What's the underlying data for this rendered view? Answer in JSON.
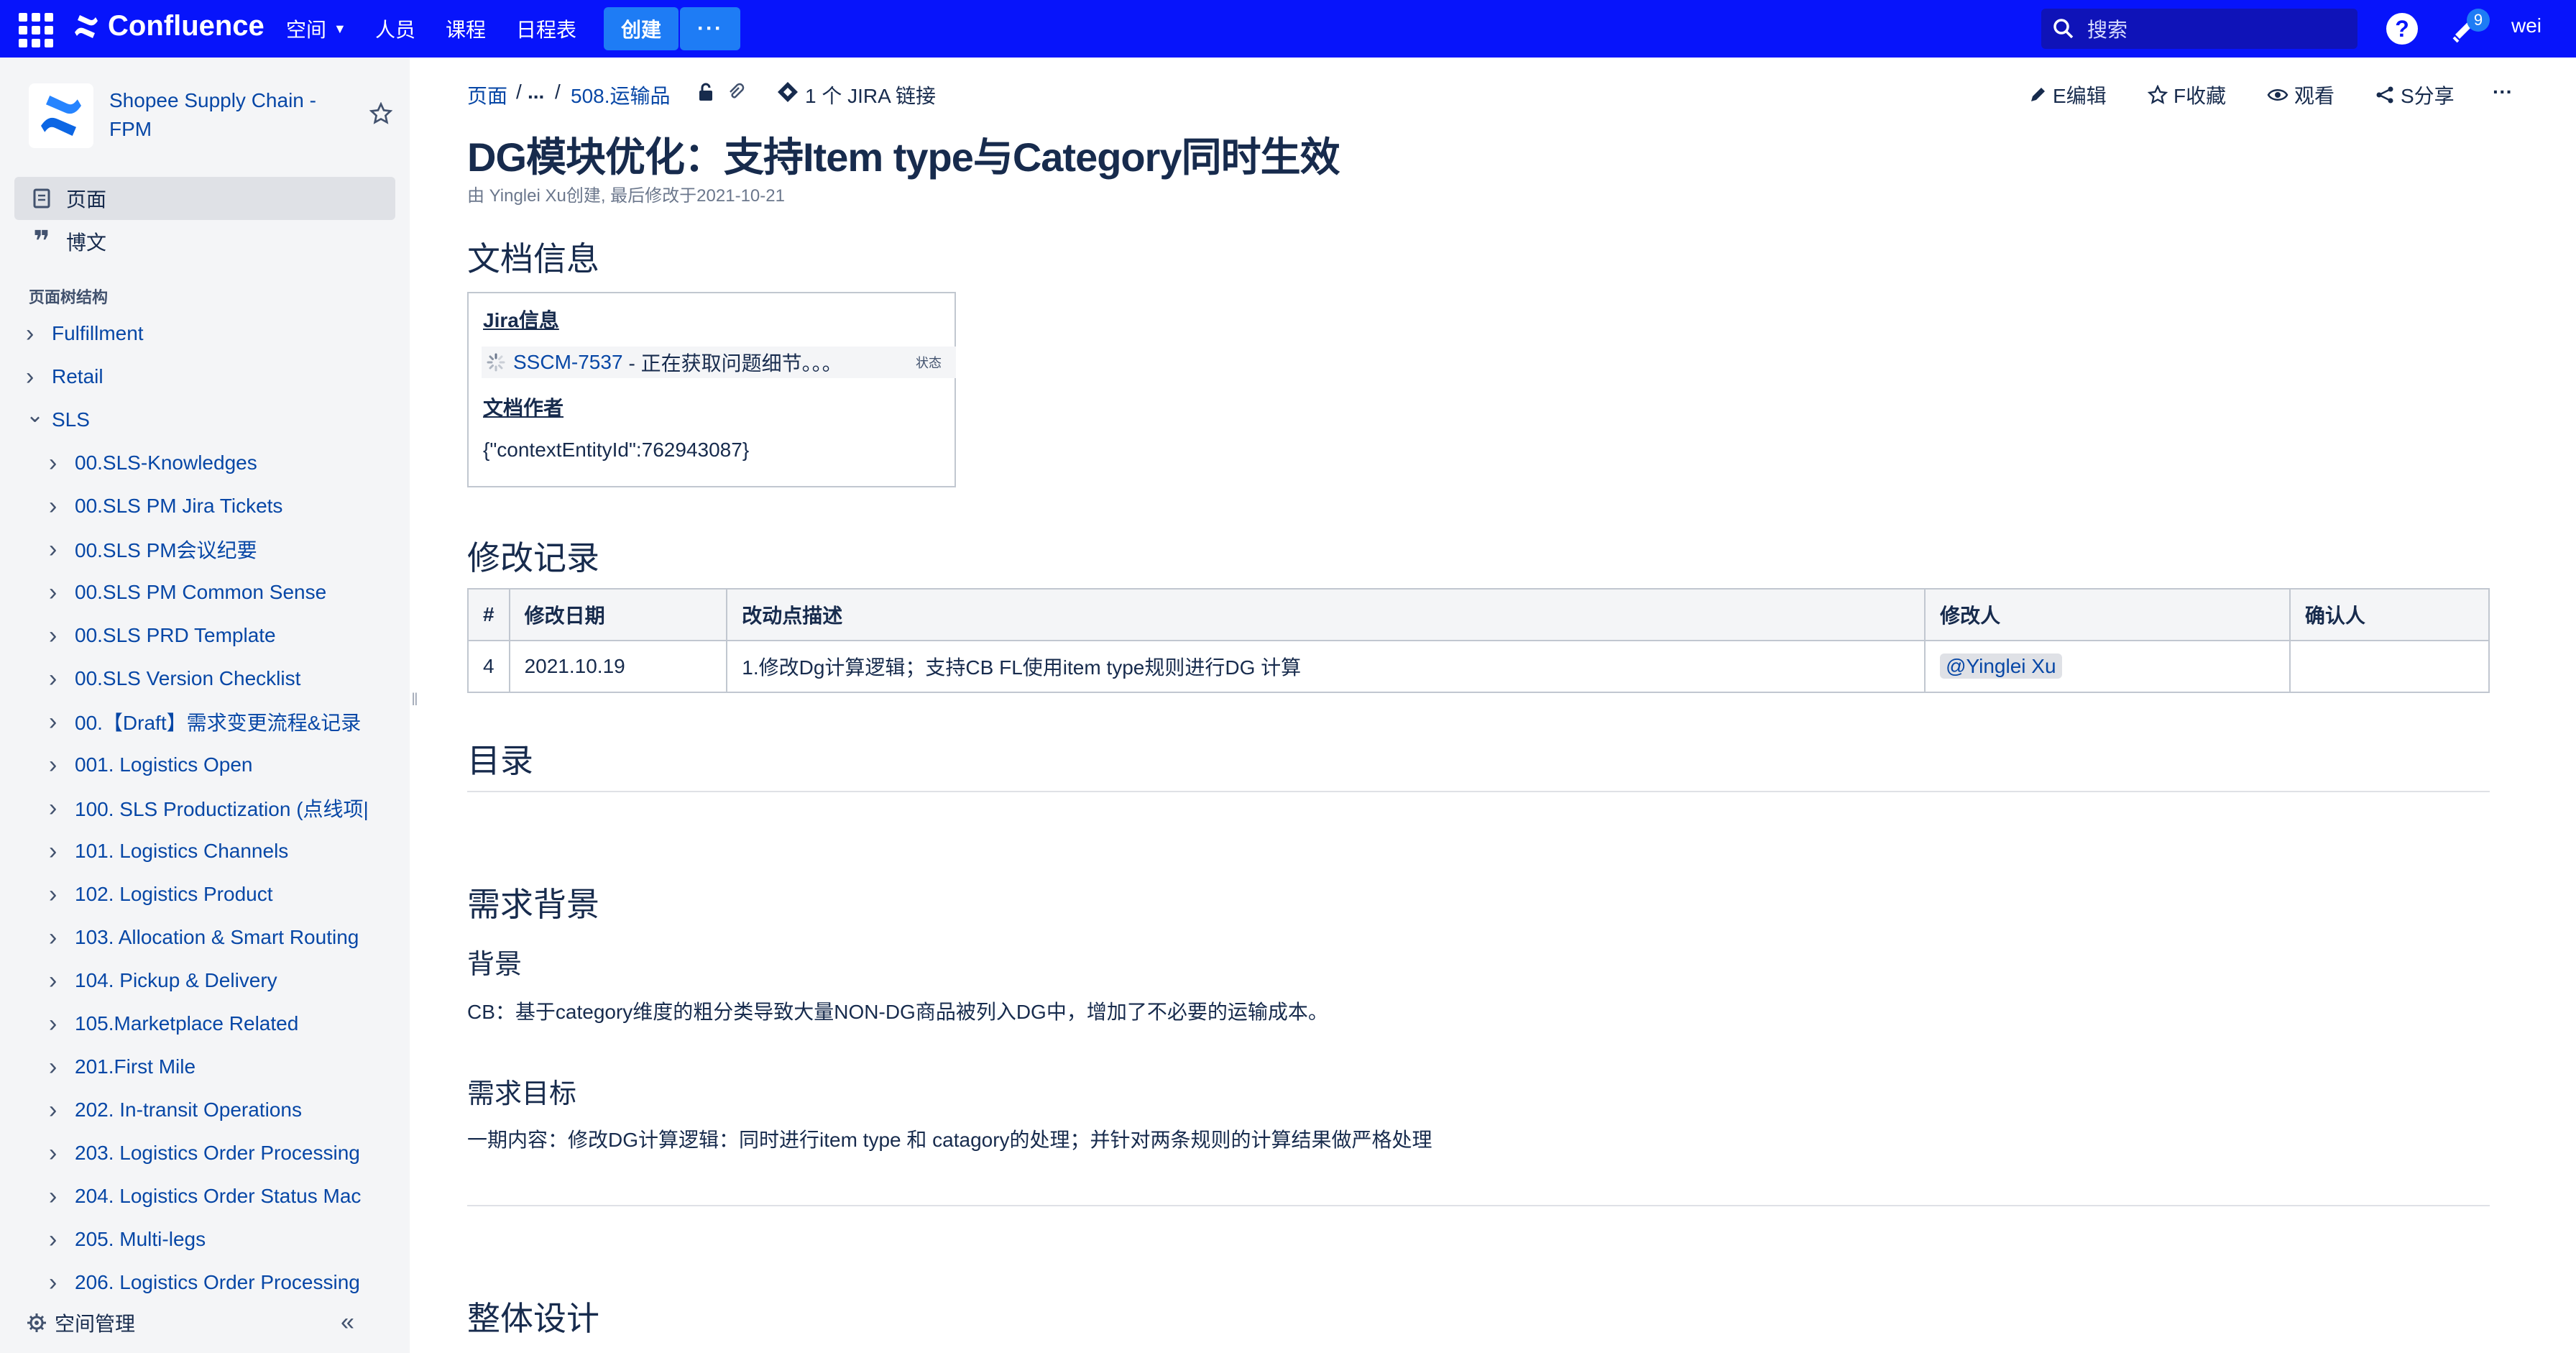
{
  "topbar": {
    "product": "Confluence",
    "nav": [
      {
        "label": "空间",
        "has_dropdown": true
      },
      {
        "label": "人员",
        "has_dropdown": false
      },
      {
        "label": "课程",
        "has_dropdown": false
      },
      {
        "label": "日程表",
        "has_dropdown": false
      }
    ],
    "create_label": "创建",
    "more_label": "···",
    "search_placeholder": "搜索",
    "help_label": "?",
    "notification_count": "9",
    "user": "wei"
  },
  "sidebar": {
    "space_name": "Shopee Supply Chain - FPM",
    "nav": [
      {
        "label": "页面",
        "icon": "page-icon",
        "active": true
      },
      {
        "label": "博文",
        "icon": "quote-icon",
        "active": false
      }
    ],
    "tree_heading": "页面树结构",
    "tree": [
      {
        "label": "Fulfillment",
        "level": 0,
        "expanded": false
      },
      {
        "label": "Retail",
        "level": 0,
        "expanded": false
      },
      {
        "label": "SLS",
        "level": 0,
        "expanded": true
      },
      {
        "label": "00.SLS-Knowledges",
        "level": 1,
        "expanded": false
      },
      {
        "label": "00.SLS PM Jira Tickets",
        "level": 1,
        "expanded": false
      },
      {
        "label": "00.SLS PM会议纪要",
        "level": 1,
        "expanded": false
      },
      {
        "label": "00.SLS PM Common Sense",
        "level": 1,
        "expanded": false
      },
      {
        "label": "00.SLS PRD Template",
        "level": 1,
        "expanded": false
      },
      {
        "label": "00.SLS Version Checklist",
        "level": 1,
        "expanded": false
      },
      {
        "label": "00.【Draft】需求变更流程&记录",
        "level": 1,
        "expanded": false
      },
      {
        "label": "001. Logistics Open",
        "level": 1,
        "expanded": false
      },
      {
        "label": "100. SLS Productization (点线项|",
        "level": 1,
        "expanded": false
      },
      {
        "label": "101. Logistics Channels",
        "level": 1,
        "expanded": false
      },
      {
        "label": "102. Logistics Product",
        "level": 1,
        "expanded": false
      },
      {
        "label": "103. Allocation & Smart Routing",
        "level": 1,
        "expanded": false
      },
      {
        "label": "104. Pickup & Delivery",
        "level": 1,
        "expanded": false
      },
      {
        "label": "105.Marketplace Related",
        "level": 1,
        "expanded": false
      },
      {
        "label": "201.First Mile",
        "level": 1,
        "expanded": false
      },
      {
        "label": "202. In-transit Operations",
        "level": 1,
        "expanded": false
      },
      {
        "label": "203. Logistics Order Processing",
        "level": 1,
        "expanded": false
      },
      {
        "label": "204. Logistics Order Status Mac",
        "level": 1,
        "expanded": false
      },
      {
        "label": "205. Multi-legs",
        "level": 1,
        "expanded": false
      },
      {
        "label": "206. Logistics Order Processing",
        "level": 1,
        "expanded": false
      }
    ],
    "footer_label": "空间管理",
    "collapse_label": "«"
  },
  "breadcrumb": {
    "root": "页面",
    "sep1": "/",
    "ellipsis": "...",
    "sep2": "/",
    "parent": "508.运输品",
    "jira_links": "1 个 JIRA 链接"
  },
  "page_actions": [
    {
      "label": "E编辑",
      "icon": "pencil-icon"
    },
    {
      "label": "F收藏",
      "icon": "star-icon"
    },
    {
      "label": "观看",
      "icon": "eye-icon"
    },
    {
      "label": "S分享",
      "icon": "share-icon"
    }
  ],
  "more_actions": "···",
  "page": {
    "title": "DG模块优化：支持Item type与Category同时生效",
    "meta": "由 Yinglei Xu创建, 最后修改于2021-10-21",
    "doc_info_heading": "文档信息",
    "jira_info_label": "Jira信息",
    "jira_key": "SSCM-7537",
    "jira_status_text": "- 正在获取问题细节。。。",
    "jira_status_badge": "状态",
    "doc_author_label": "文档作者",
    "doc_author_value": "{\"contextEntityId\":762943087}",
    "change_log_heading": "修改记录",
    "table": {
      "headers": [
        "#",
        "修改日期",
        "改动点描述",
        "修改人",
        "确认人"
      ],
      "rows": [
        [
          "4",
          "2021.10.19",
          "1.修改Dg计算逻辑；支持CB FL使用item type规则进行DG 计算",
          "@Yinglei Xu",
          ""
        ]
      ]
    },
    "toc_heading": "目录",
    "background_heading": "需求背景",
    "background_sub": "背景",
    "background_text": "CB：基于category维度的粗分类导致大量NON-DG商品被列入DG中，增加了不必要的运输成本。",
    "goal_sub": "需求目标",
    "goal_text": "一期内容：修改DG计算逻辑：同时进行item type 和 catagory的处理；并针对两条规则的计算结果做严格处理",
    "design_heading": "整体设计"
  },
  "colors": {
    "topbar": "#0714fb",
    "create_button": "#1e7cf5",
    "link": "#0747a6",
    "sidebar_bg": "#f4f5f7"
  }
}
